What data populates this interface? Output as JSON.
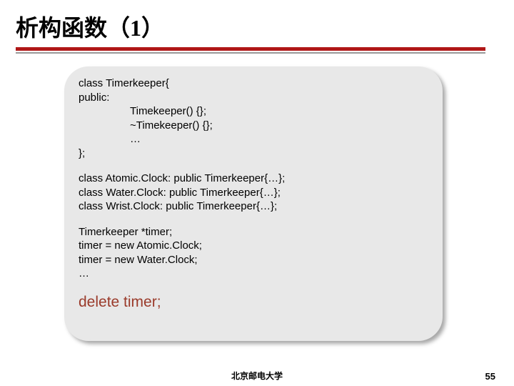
{
  "title": "析构函数（1）",
  "code": {
    "l1": "class Timerkeeper{",
    "l2": "public:",
    "l3": "Timekeeper() {};",
    "l4": "~Timekeeper() {};",
    "l5": "…",
    "l6": "};",
    "l7": "class Atomic.Clock: public Timerkeeper{…};",
    "l8": "class Water.Clock: public Timerkeeper{…};",
    "l9": "class Wrist.Clock: public Timerkeeper{…};",
    "l10": "Timerkeeper *timer;",
    "l11": "timer = new Atomic.Clock;",
    "l12": "timer = new Water.Clock;",
    "l13": "…",
    "l14": "delete timer;"
  },
  "footer": {
    "university": "北京邮电大学",
    "page": "55"
  }
}
